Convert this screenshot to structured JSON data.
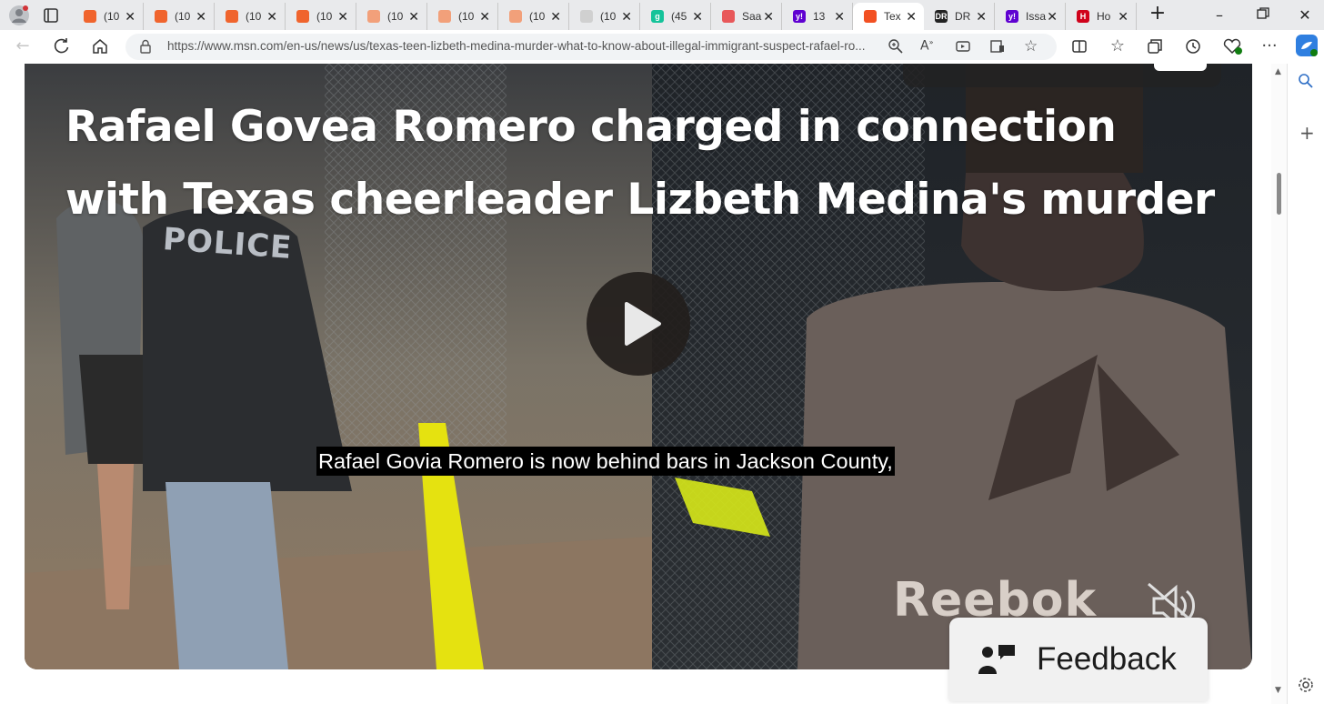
{
  "browser": {
    "tabs": [
      {
        "label": "(10",
        "favicon_color": "#f0642d",
        "favicon_glyph": "bookmark-icon"
      },
      {
        "label": "(10",
        "favicon_color": "#f0642d",
        "favicon_glyph": "bookmark-icon"
      },
      {
        "label": "(10",
        "favicon_color": "#f0642d",
        "favicon_glyph": "bookmark-icon"
      },
      {
        "label": "(10",
        "favicon_color": "#f0642d",
        "favicon_glyph": "bookmark-icon"
      },
      {
        "label": "(10",
        "favicon_color": "#f2a07a",
        "favicon_glyph": "bookmark-icon"
      },
      {
        "label": "(10",
        "favicon_color": "#f2a07a",
        "favicon_glyph": "bookmark-icon"
      },
      {
        "label": "(10",
        "favicon_color": "#f2a07a",
        "favicon_glyph": "bookmark-icon"
      },
      {
        "label": "(10",
        "favicon_color": "#d0d0d0",
        "favicon_glyph": "image-icon"
      },
      {
        "label": "(45",
        "favicon_color": "#15c39a",
        "favicon_glyph": "g"
      },
      {
        "label": "Saa",
        "favicon_color": "#e8585a",
        "favicon_glyph": "youtube-icon"
      },
      {
        "label": "13",
        "favicon_color": "#5f01d1",
        "favicon_glyph": "y!"
      },
      {
        "label": "Tex",
        "favicon_color": "#f25022",
        "favicon_glyph": "msn-icon",
        "active": true
      },
      {
        "label": "DR",
        "favicon_color": "#222222",
        "favicon_glyph": "DR"
      },
      {
        "label": "Issa",
        "favicon_color": "#5f01d1",
        "favicon_glyph": "y!"
      },
      {
        "label": "Ho",
        "favicon_color": "#d0021b",
        "favicon_glyph": "H"
      }
    ],
    "url": "https://www.msn.com/en-us/news/us/texas-teen-lizbeth-medina-murder-what-to-know-about-illegal-immigrant-suspect-rafael-ro..."
  },
  "video": {
    "headline": "Rafael Govea Romero charged in connection with Texas cheerleader Lizbeth Medina's murder",
    "caption": "Rafael Govia Romero is now behind bars in Jackson County,",
    "scene_text_police": "POLICE",
    "scene_text_brand": "Reebok",
    "muted": true
  },
  "feedback": {
    "label": "Feedback"
  },
  "colors": {
    "tabstrip_bg": "#e9eaec",
    "accent_blue": "#0a66c2",
    "caption_bg": "#000000",
    "highlight_yellow": "#e2e200"
  }
}
